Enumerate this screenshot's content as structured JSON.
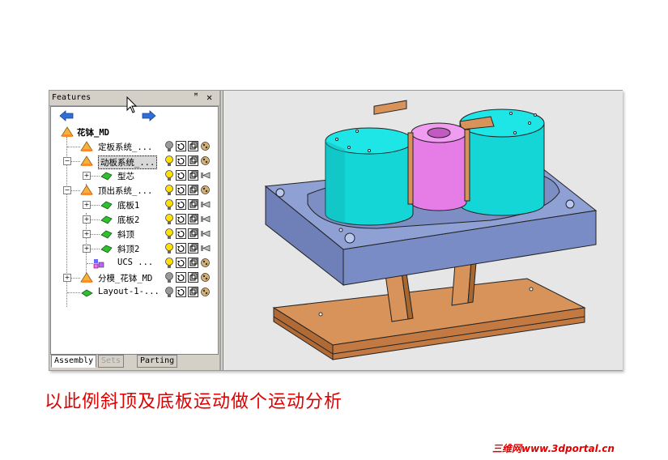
{
  "panel": {
    "title": "Features",
    "pin": "ꟸ",
    "close": "✕"
  },
  "tree": {
    "root": "花钵_MD",
    "items": [
      {
        "label": "定板系统_...",
        "expander": "",
        "icon": "assembly-icon",
        "selected": false
      },
      {
        "label": "动板系统_...",
        "expander": "−",
        "icon": "assembly-icon",
        "selected": true
      },
      {
        "label": "型芯",
        "expander": "+",
        "icon": "part-icon",
        "selected": false
      },
      {
        "label": "顶出系统_...",
        "expander": "−",
        "icon": "assembly-icon",
        "selected": false
      },
      {
        "label": "底板1",
        "expander": "+",
        "icon": "part-icon",
        "selected": false
      },
      {
        "label": "底板2",
        "expander": "+",
        "icon": "part-icon",
        "selected": false
      },
      {
        "label": "斜顶",
        "expander": "+",
        "icon": "part-icon",
        "selected": false
      },
      {
        "label": "斜顶2",
        "expander": "+",
        "icon": "part-icon",
        "selected": false
      },
      {
        "label": "UCS ...",
        "expander": "",
        "icon": "ucs-icon",
        "selected": false
      },
      {
        "label": "分模_花钵_MD",
        "expander": "+",
        "icon": "assembly-icon",
        "selected": false
      },
      {
        "label": "Layout-1-...",
        "expander": "",
        "icon": "layout-icon",
        "selected": false
      }
    ]
  },
  "tabs": [
    "Assembly",
    "Sets",
    "Parting"
  ],
  "caption": "以此例斜顶及底板运动做个运动分析",
  "watermark": "三维网www.3dportal.cn",
  "colors": {
    "caption": "#e00000",
    "cylinder": "#14d6d6",
    "core": "#e67ce6",
    "plate": "#8fa0d4",
    "base": "#d7935a"
  }
}
